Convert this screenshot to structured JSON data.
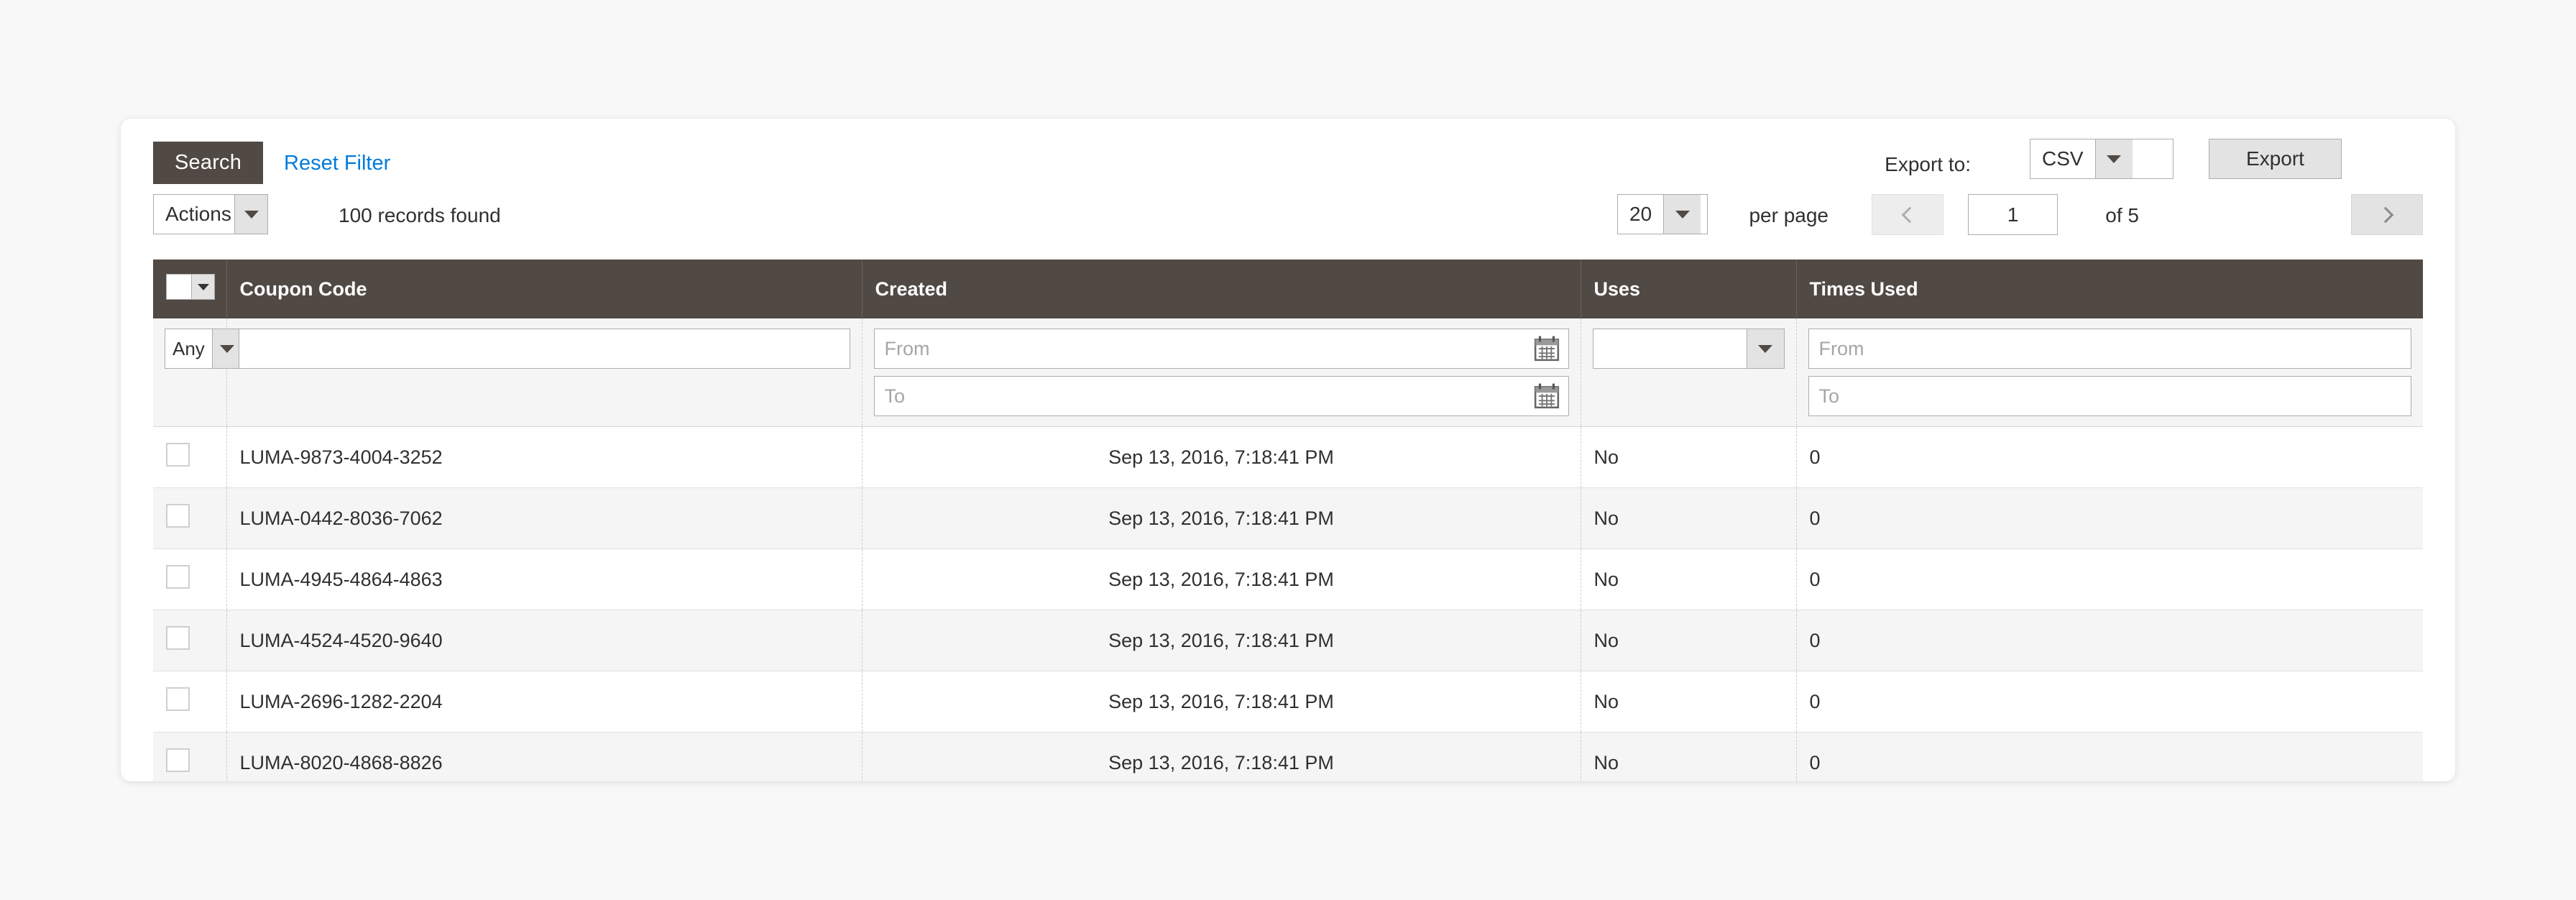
{
  "toolbar": {
    "search_label": "Search",
    "reset_filter_label": "Reset Filter",
    "export_to_label": "Export to:",
    "export_format": "CSV",
    "export_button_label": "Export",
    "actions_label": "Actions",
    "records_found": "100 records found",
    "per_page_value": "20",
    "per_page_label": "per page",
    "page_number": "1",
    "page_of": "of 5"
  },
  "grid": {
    "columns": [
      {
        "key": "checkbox",
        "label": ""
      },
      {
        "key": "code",
        "label": "Coupon Code"
      },
      {
        "key": "created",
        "label": "Created"
      },
      {
        "key": "uses",
        "label": "Uses"
      },
      {
        "key": "times_used",
        "label": "Times Used"
      }
    ],
    "filters": {
      "code_match": "Any",
      "code_value": "",
      "created_from_placeholder": "From",
      "created_to_placeholder": "To",
      "uses_value": "",
      "times_used_from_placeholder": "From",
      "times_used_to_placeholder": "To"
    },
    "rows": [
      {
        "code": "LUMA-9873-4004-3252",
        "created": "Sep 13, 2016, 7:18:41 PM",
        "uses": "No",
        "times_used": "0"
      },
      {
        "code": "LUMA-0442-8036-7062",
        "created": "Sep 13, 2016, 7:18:41 PM",
        "uses": "No",
        "times_used": "0"
      },
      {
        "code": "LUMA-4945-4864-4863",
        "created": "Sep 13, 2016, 7:18:41 PM",
        "uses": "No",
        "times_used": "0"
      },
      {
        "code": "LUMA-4524-4520-9640",
        "created": "Sep 13, 2016, 7:18:41 PM",
        "uses": "No",
        "times_used": "0"
      },
      {
        "code": "LUMA-2696-1282-2204",
        "created": "Sep 13, 2016, 7:18:41 PM",
        "uses": "No",
        "times_used": "0"
      },
      {
        "code": "LUMA-8020-4868-8826",
        "created": "Sep 13, 2016, 7:18:41 PM",
        "uses": "No",
        "times_used": "0"
      }
    ]
  },
  "colors": {
    "header_bg": "#514943",
    "link": "#007bdb",
    "row_alt_bg": "#f5f5f5",
    "page_bg": "#f8f8f8"
  }
}
